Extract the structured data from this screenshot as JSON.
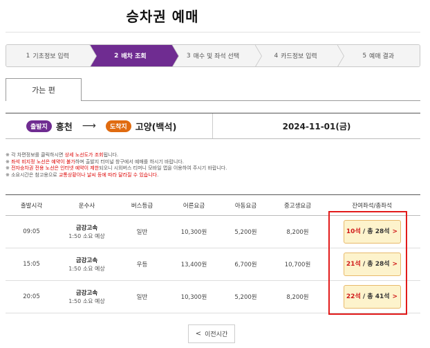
{
  "page": {
    "title": "승차권 예매"
  },
  "stepper": [
    {
      "num": "1",
      "label": "기초정보 입력",
      "active": false
    },
    {
      "num": "2",
      "label": "배차 조회",
      "active": true
    },
    {
      "num": "3",
      "label": "매수 및 좌석 선택",
      "active": false
    },
    {
      "num": "4",
      "label": "카드정보 입력",
      "active": false
    },
    {
      "num": "5",
      "label": "예매 결과",
      "active": false
    }
  ],
  "tab": {
    "label": "가는 편"
  },
  "route": {
    "departure_badge": "출발지",
    "departure": "홍천",
    "arrival_badge": "도착지",
    "arrival": "고양(백석)",
    "date": "2024-11-01(금)"
  },
  "notes": [
    {
      "pre": "※ 각 차편정보를 클릭하시면 ",
      "red": "상세 노선도가 조회",
      "post": "됩니다."
    },
    {
      "pre": "※ ",
      "red": "좌석 비지정 노선은 예약이 불가",
      "post": "하며 출발지 터미널 창구에서 예매를 하시기 바랍니다."
    },
    {
      "pre": "※ ",
      "red": "전자승차권 전용 노선은 인터넷 예약이 제한",
      "post": "되오니 시외버스 티머니 모바일 앱을 이용하여 주시기 바랍니다."
    },
    {
      "pre": "※ 소요시간은 참고용으로 ",
      "red": "교통상황이나 날씨 등에 따라 달라질 수 있습니다",
      "post": "."
    }
  ],
  "table": {
    "headers": [
      "출발시각",
      "운수사",
      "버스등급",
      "어른요금",
      "아동요금",
      "중고생요금",
      "잔여좌석/총좌석"
    ],
    "rows": [
      {
        "time": "09:05",
        "company": "금강고속",
        "duration": "1:50 소요 예상",
        "grade": "일반",
        "adult": "10,300원",
        "child": "5,200원",
        "student": "8,200원",
        "remain": "10석",
        "total": "/ 총 28석",
        "chev": ">"
      },
      {
        "time": "15:05",
        "company": "금강고속",
        "duration": "1:50 소요 예상",
        "grade": "우등",
        "adult": "13,400원",
        "child": "6,700원",
        "student": "10,700원",
        "remain": "21석",
        "total": "/ 총 28석",
        "chev": ">"
      },
      {
        "time": "20:05",
        "company": "금강고속",
        "duration": "1:50 소요 예상",
        "grade": "일반",
        "adult": "10,300원",
        "child": "5,200원",
        "student": "8,200원",
        "remain": "22석",
        "total": "/ 총 41석",
        "chev": ">"
      }
    ]
  },
  "prev_button": {
    "chev": "<",
    "label": "이전시간"
  },
  "colors": {
    "accent": "#6f2c91",
    "arrival_badge": "#e06b10",
    "highlight": "#e21a1a",
    "seat_bg": "#fdf3cc"
  }
}
